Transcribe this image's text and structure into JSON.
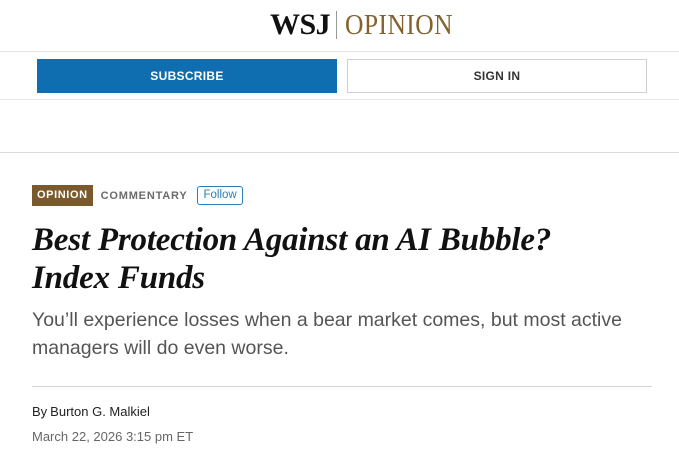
{
  "masthead": {
    "brand": "WSJ",
    "section": "OPINION"
  },
  "auth": {
    "subscribe_label": "SUBSCRIBE",
    "signin_label": "SIGN IN"
  },
  "article": {
    "tags": {
      "section": "OPINION",
      "category": "COMMENTARY",
      "follow_label": "Follow"
    },
    "headline_line1": "Best Protection Against an AI Bubble?",
    "headline_line2": "Index Funds",
    "dek": "You’ll experience losses when a bear market comes, but most active managers will do even worse.",
    "byline_prefix": "By",
    "author": "Burton G. Malkiel",
    "timestamp": "March 22, 2026 3:15 pm ET"
  },
  "colors": {
    "opinion_brown": "#84622f",
    "subscribe_blue": "#0f6eb0",
    "follow_blue": "#2a7fb8"
  }
}
